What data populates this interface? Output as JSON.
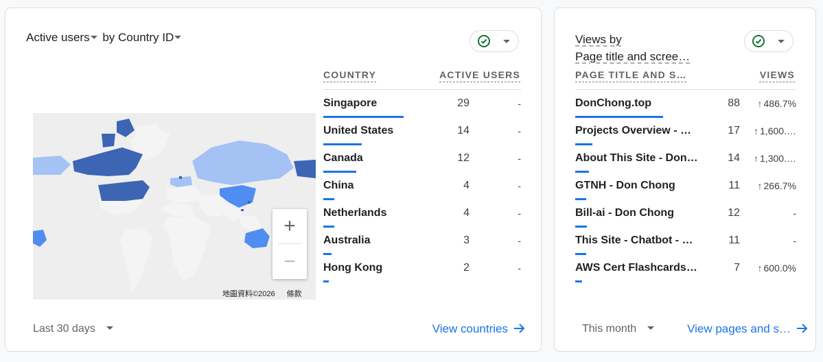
{
  "country_card": {
    "title_metric": "Active users",
    "title_by": "by",
    "title_dimension": "Country ID",
    "columns": {
      "dimension": "COUNTRY",
      "metric": "ACTIVE USERS"
    },
    "rows": [
      {
        "name": "Singapore",
        "value": "29",
        "change": "-",
        "share": 1.0
      },
      {
        "name": "United States",
        "value": "14",
        "change": "-",
        "share": 0.4828
      },
      {
        "name": "Canada",
        "value": "12",
        "change": "-",
        "share": 0.4138
      },
      {
        "name": "China",
        "value": "4",
        "change": "-",
        "share": 0.1379
      },
      {
        "name": "Netherlands",
        "value": "4",
        "change": "-",
        "share": 0.1379
      },
      {
        "name": "Australia",
        "value": "3",
        "change": "-",
        "share": 0.1034
      },
      {
        "name": "Hong Kong",
        "value": "2",
        "change": "-",
        "share": 0.069
      }
    ],
    "map": {
      "zoom_in": "+",
      "zoom_out": "−",
      "attribution": "地圖資料©2026",
      "terms": "條款",
      "colors": {
        "high": "#3c65b4",
        "mid": "#4f8df3",
        "low": "#a4c2f4",
        "none": "#f1f3f4",
        "water": "#eeeeee"
      }
    },
    "date_range": "Last 30 days",
    "link": "View countries"
  },
  "pages_card": {
    "title_line1": "Views by",
    "title_line2": "Page title and scree…",
    "columns": {
      "dimension": "PAGE TITLE AND S…",
      "metric": "VIEWS"
    },
    "rows": [
      {
        "name": "DonChong.top",
        "value": "88",
        "change": "486.7%",
        "up": true,
        "share": 1.0
      },
      {
        "name": "Projects Overview - …",
        "value": "17",
        "change": "1,600.…",
        "up": true,
        "share": 0.1932
      },
      {
        "name": "About This Site - Don…",
        "value": "14",
        "change": "1,300.…",
        "up": true,
        "share": 0.1591
      },
      {
        "name": "GTNH - Don Chong",
        "value": "11",
        "change": "266.7%",
        "up": true,
        "share": 0.125
      },
      {
        "name": "Bill-ai - Don Chong",
        "value": "12",
        "change": "-",
        "up": false,
        "share": 0.1364
      },
      {
        "name": "This Site - Chatbot - …",
        "value": "11",
        "change": "-",
        "up": false,
        "share": 0.125
      },
      {
        "name": "AWS Cert Flashcards…",
        "value": "7",
        "change": "600.0%",
        "up": true,
        "share": 0.0795
      }
    ],
    "date_range": "This month",
    "link": "View pages and s…"
  },
  "colors": {
    "accent": "#1a73e8",
    "positive": "#137333"
  }
}
